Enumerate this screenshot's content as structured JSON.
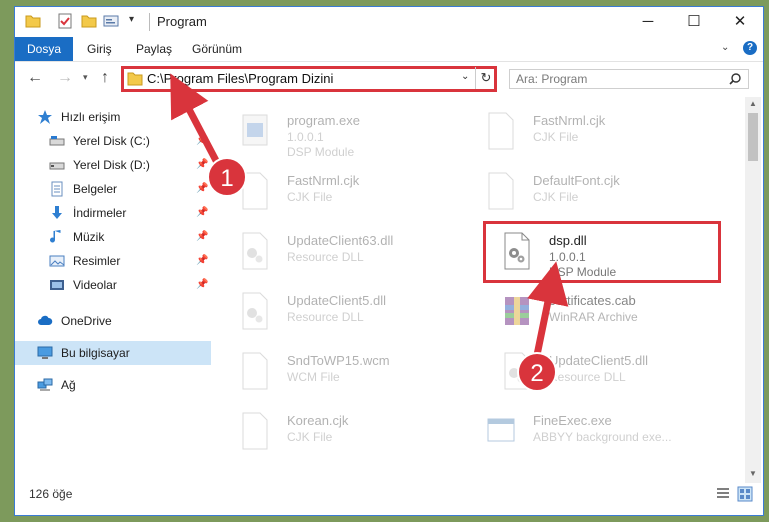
{
  "window": {
    "title": "Program",
    "controls": {
      "minimize": "─",
      "maximize": "☐",
      "close": "✕"
    }
  },
  "ribbon": {
    "tabs": [
      "Dosya",
      "Giriş",
      "Paylaş",
      "Görünüm"
    ],
    "help": "?"
  },
  "nav": {
    "address": "C:\\Program Files\\Program Dizini",
    "search_placeholder": "Ara: Program"
  },
  "sidebar": {
    "items": [
      {
        "label": "Hızlı erişim",
        "icon": "star-icon"
      },
      {
        "label": "Yerel Disk (C:)",
        "icon": "drive-icon",
        "pinned": true
      },
      {
        "label": "Yerel Disk (D:)",
        "icon": "drive-icon",
        "pinned": true
      },
      {
        "label": "Belgeler",
        "icon": "documents-icon",
        "pinned": true
      },
      {
        "label": "İndirmeler",
        "icon": "download-icon",
        "pinned": true
      },
      {
        "label": "Müzik",
        "icon": "music-icon",
        "pinned": true
      },
      {
        "label": "Resimler",
        "icon": "pictures-icon",
        "pinned": true
      },
      {
        "label": "Videolar",
        "icon": "videos-icon",
        "pinned": true
      },
      {
        "label": "OneDrive",
        "icon": "cloud-icon"
      },
      {
        "label": "Bu bilgisayar",
        "icon": "computer-icon",
        "selected": true
      },
      {
        "label": "Ağ",
        "icon": "network-icon"
      }
    ]
  },
  "files": [
    {
      "name": "program.exe",
      "line1": "1.0.0.1",
      "line2": "DSP Module",
      "icon": "exe-icon"
    },
    {
      "name": "FastNrml.cjk",
      "line1": "CJK File",
      "line2": "",
      "icon": "blank-file-icon"
    },
    {
      "name": "FastNrml.cjk",
      "line1": "CJK File",
      "line2": "",
      "icon": "blank-file-icon"
    },
    {
      "name": "DefaultFont.cjk",
      "line1": "CJK File",
      "line2": "",
      "icon": "blank-file-icon"
    },
    {
      "name": "UpdateClient63.dll",
      "line1": "Resource DLL",
      "line2": "",
      "icon": "dll-icon"
    },
    {
      "name": "dsp.dll",
      "line1": "1.0.0.1",
      "line2": "DSP Module",
      "icon": "dll-icon"
    },
    {
      "name": "UpdateClient5.dll",
      "line1": "Resource DLL",
      "line2": "",
      "icon": "dll-icon"
    },
    {
      "name": "certificates.cab",
      "line1": "WinRAR Archive",
      "line2": "",
      "icon": "archive-icon"
    },
    {
      "name": "SndToWP15.wcm",
      "line1": "WCM File",
      "line2": "",
      "icon": "blank-file-icon"
    },
    {
      "name": "UpdateClient5.dll",
      "line1": "Resource DLL",
      "line2": "",
      "icon": "dll-icon"
    },
    {
      "name": "Korean.cjk",
      "line1": "CJK File",
      "line2": "",
      "icon": "blank-file-icon"
    },
    {
      "name": "FineExec.exe",
      "line1": "ABBYY background exe...",
      "line2": "",
      "icon": "app-window-icon"
    }
  ],
  "status": {
    "count": "126 öğe"
  },
  "annotations": {
    "step1": "1",
    "step2": "2"
  },
  "colors": {
    "accent": "#1a6dc4",
    "highlight": "#d9343c",
    "selected": "#cce4f7"
  }
}
